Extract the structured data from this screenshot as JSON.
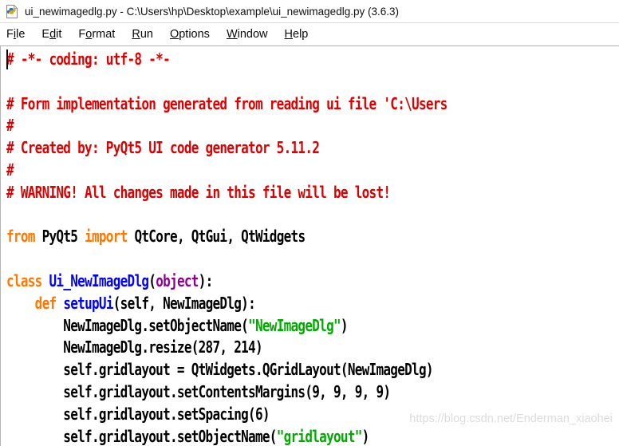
{
  "window": {
    "icon": "python-file-icon",
    "title": "ui_newimagedlg.py - C:\\Users\\hp\\Desktop\\example\\ui_newimagedlg.py (3.6.3)"
  },
  "menu": {
    "items": [
      {
        "label": "File",
        "accel_index": 1
      },
      {
        "label": "Edit",
        "accel_index": 1
      },
      {
        "label": "Format",
        "accel_index": 1
      },
      {
        "label": "Run",
        "accel_index": 0
      },
      {
        "label": "Options",
        "accel_index": 0
      },
      {
        "label": "Window",
        "accel_index": 0
      },
      {
        "label": "Help",
        "accel_index": 0
      }
    ]
  },
  "editor": {
    "caret_line": 1,
    "caret_column": 1,
    "colors": {
      "comment": "#dd0000",
      "keyword": "#ff7700",
      "definition": "#0000ff",
      "builtin": "#900090",
      "string": "#00aa00",
      "plain": "#000000",
      "background": "#ffffff"
    },
    "lines": [
      {
        "tokens": [
          {
            "t": "# -*- coding: utf-8 -*-",
            "c": "comment"
          }
        ]
      },
      {
        "tokens": []
      },
      {
        "tokens": [
          {
            "t": "# Form implementation generated from reading ui file 'C:\\Users",
            "c": "comment"
          }
        ]
      },
      {
        "tokens": [
          {
            "t": "#",
            "c": "comment"
          }
        ]
      },
      {
        "tokens": [
          {
            "t": "# Created by: PyQt5 UI code generator 5.11.2",
            "c": "comment"
          }
        ]
      },
      {
        "tokens": [
          {
            "t": "#",
            "c": "comment"
          }
        ]
      },
      {
        "tokens": [
          {
            "t": "# WARNING! All changes made in this file will be lost!",
            "c": "comment"
          }
        ]
      },
      {
        "tokens": []
      },
      {
        "tokens": [
          {
            "t": "from",
            "c": "keyword"
          },
          {
            "t": " PyQt5 ",
            "c": "plain"
          },
          {
            "t": "import",
            "c": "keyword"
          },
          {
            "t": " QtCore, QtGui, QtWidgets",
            "c": "plain"
          }
        ]
      },
      {
        "tokens": []
      },
      {
        "tokens": [
          {
            "t": "class",
            "c": "keyword"
          },
          {
            "t": " ",
            "c": "plain"
          },
          {
            "t": "Ui_NewImageDlg",
            "c": "definition"
          },
          {
            "t": "(",
            "c": "plain"
          },
          {
            "t": "object",
            "c": "builtin"
          },
          {
            "t": "):",
            "c": "plain"
          }
        ]
      },
      {
        "tokens": [
          {
            "t": "    ",
            "c": "plain"
          },
          {
            "t": "def",
            "c": "keyword"
          },
          {
            "t": " ",
            "c": "plain"
          },
          {
            "t": "setupUi",
            "c": "definition"
          },
          {
            "t": "(self, NewImageDlg):",
            "c": "plain"
          }
        ]
      },
      {
        "tokens": [
          {
            "t": "        NewImageDlg.setObjectName(",
            "c": "plain"
          },
          {
            "t": "\"NewImageDlg\"",
            "c": "string"
          },
          {
            "t": ")",
            "c": "plain"
          }
        ]
      },
      {
        "tokens": [
          {
            "t": "        NewImageDlg.resize(287, 214)",
            "c": "plain"
          }
        ]
      },
      {
        "tokens": [
          {
            "t": "        self.gridlayout = QtWidgets.QGridLayout(NewImageDlg)",
            "c": "plain"
          }
        ]
      },
      {
        "tokens": [
          {
            "t": "        self.gridlayout.setContentsMargins(9, 9, 9, 9)",
            "c": "plain"
          }
        ]
      },
      {
        "tokens": [
          {
            "t": "        self.gridlayout.setSpacing(6)",
            "c": "plain"
          }
        ]
      },
      {
        "tokens": [
          {
            "t": "        self.gridlayout.setObjectName(",
            "c": "plain"
          },
          {
            "t": "\"gridlayout\"",
            "c": "string"
          },
          {
            "t": ")",
            "c": "plain"
          }
        ]
      }
    ]
  },
  "watermark": {
    "text": "https://blog.csdn.net/Enderman_xiaohei"
  }
}
